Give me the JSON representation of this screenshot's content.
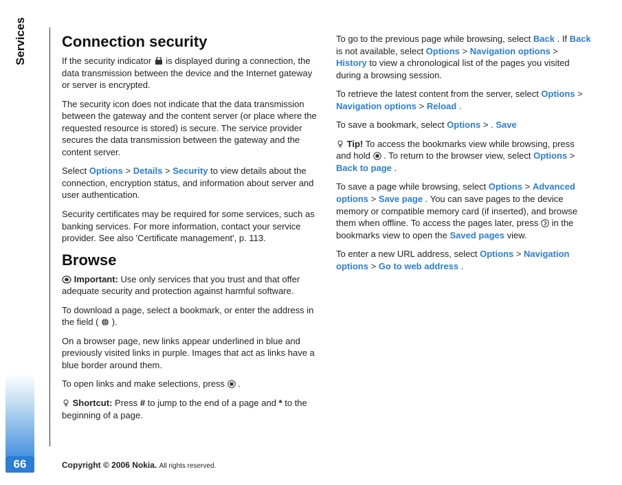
{
  "side_label": "Services",
  "page_number": "66",
  "footer": {
    "brand": "Copyright © 2006 Nokia.",
    "rights": "All rights reserved."
  },
  "h_connection": "Connection security",
  "p_conn_1a": "If the security indicator ",
  "p_conn_1b": " is displayed during a connection, the data transmission between the device and the Internet gateway or server is encrypted.",
  "p_conn_2": "The security icon does not indicate that the data transmission between the gateway and the content server (or place where the requested resource is stored) is secure. The service provider secures the data transmission between the gateway and the content server.",
  "p_conn_3_a": "Select ",
  "p_conn_3_opt": "Options",
  "p_conn_3_det": "Details",
  "p_conn_3_sec": "Security",
  "p_conn_3_b": " to view details about the connection, encryption status, and information about server and user authentication.",
  "p_conn_4": "Security certificates may be required for some services, such as banking services. For more information, contact your service provider. See also 'Certificate management', p. 113.",
  "h_browse": "Browse",
  "p_browse_imp_label": "Important:",
  "p_browse_imp_text": " Use only services that you trust and that offer adequate security and protection against harmful software.",
  "p_browse_dl_a": "To download a page, select a bookmark, or enter the address in the field ( ",
  "p_browse_dl_b": " ).",
  "p_browse_links": "On a browser page, new links appear underlined in blue and previously visited links in purple. Images that act as links have a blue border around them.",
  "p_browse_open_a": "To open links and make selections, press ",
  "p_browse_open_b": ".",
  "p_shortcut_label": "Shortcut:",
  "p_shortcut_a": " Press ",
  "p_shortcut_hash": "#",
  "p_shortcut_b": " to jump to the end of a page and ",
  "p_shortcut_star": "*",
  "p_shortcut_c": " to the beginning of a page.",
  "p_prev_a": "To go to the previous page while browsing, select ",
  "p_prev_back": "Back",
  "p_prev_b": ". If ",
  "p_prev_c": " is not available, select ",
  "p_prev_opt": "Options",
  "p_prev_nav": "Navigation options",
  "p_prev_hist": "History",
  "p_prev_d": " to view a chronological list of the pages you visited during a browsing session.",
  "p_reload_a": "To retrieve the latest content from the server, select ",
  "p_reload_opt": "Options",
  "p_reload_nav": "Navigation options",
  "p_reload_rel": "Reload",
  "p_reload_b": ".",
  "p_savebk_a": "To save a bookmark, select ",
  "p_savebk_opt": "Options",
  "p_savebk_sep": " > .",
  "p_savebk_save": "Save",
  "p_tip_label": "Tip!",
  "p_tip_a": " To access the bookmarks view while browsing, press and hold ",
  "p_tip_b": ". To return to the browser view, select ",
  "p_tip_opt": "Options",
  "p_tip_back": "Back to page",
  "p_tip_c": ".",
  "p_savepg_a": "To save a page while browsing, select ",
  "p_savepg_opt": "Options",
  "p_savepg_adv": "Advanced options",
  "p_savepg_sp": "Save page",
  "p_savepg_b": ". You can save pages to the device memory or compatible memory card (if inserted), and browse them when offline. To access the pages later, press ",
  "p_savepg_c": " in the bookmarks view to open the ",
  "p_savepg_sv": "Saved pages",
  "p_savepg_d": " view.",
  "p_url_a": "To enter a new URL address, select ",
  "p_url_opt": "Options",
  "p_url_nav": "Navigation options",
  "p_url_go": "Go to web address",
  "p_url_b": "."
}
